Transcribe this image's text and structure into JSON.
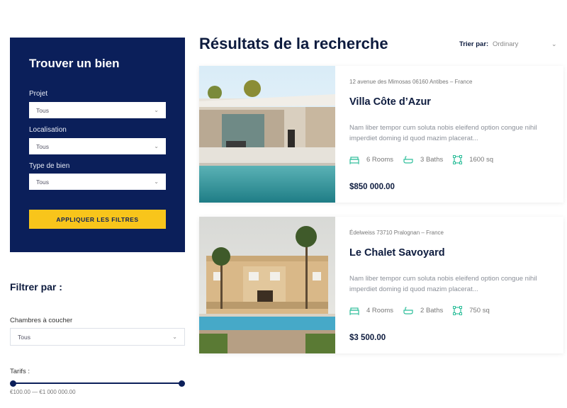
{
  "search_panel": {
    "title": "Trouver un bien",
    "project_label": "Projet",
    "project_value": "Tous",
    "location_label": "Localisation",
    "location_value": "Tous",
    "type_label": "Type de bien",
    "type_value": "Tous",
    "apply_label": "APPLIQUER LES FILTRES"
  },
  "filters": {
    "title": "Filtrer par :",
    "bedrooms_label": "Chambres à coucher",
    "bedrooms_value": "Tous",
    "price_label": "Tarifs :",
    "price_range": "€100.00 — €1 000 000.00"
  },
  "results": {
    "title": "Résultats de la recherche",
    "sort_label": "Trier par:",
    "sort_value": "Ordinary"
  },
  "listings": [
    {
      "address": "12 avenue des Mimosas 06160 Antibes – France",
      "title": "Villa Côte d’Azur",
      "description": "Nam liber tempor cum soluta nobis eleifend option congue nihil imperdiet doming id quod mazim placerat...",
      "rooms": "6 Rooms",
      "baths": "3 Baths",
      "area": "1600 sq",
      "price": "$850 000.00"
    },
    {
      "address": "Édelweiss 73710 Pralognan – France",
      "title": "Le Chalet Savoyard",
      "description": "Nam liber tempor cum soluta nobis eleifend option congue nihil imperdiet doming id quod mazim placerat...",
      "rooms": "4 Rooms",
      "baths": "2 Baths",
      "area": "750 sq",
      "price": "$3 500.00"
    }
  ],
  "colors": {
    "navy": "#0b1f5a",
    "accent_yellow": "#f8c51b",
    "icon_green": "#2fbf9b"
  }
}
